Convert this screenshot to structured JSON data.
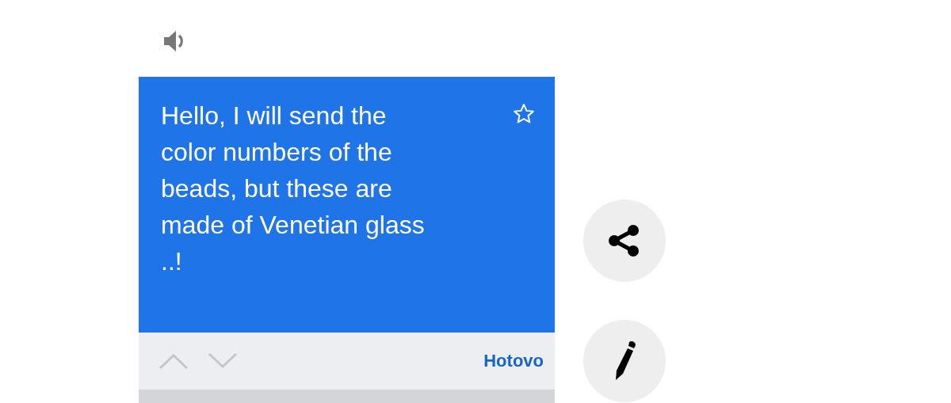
{
  "translation": {
    "text": "Hello, I will send the color numbers of the beads, but these are made of Venetian glass ..!",
    "starred": false
  },
  "toolbar": {
    "done_label": "Hotovo"
  }
}
